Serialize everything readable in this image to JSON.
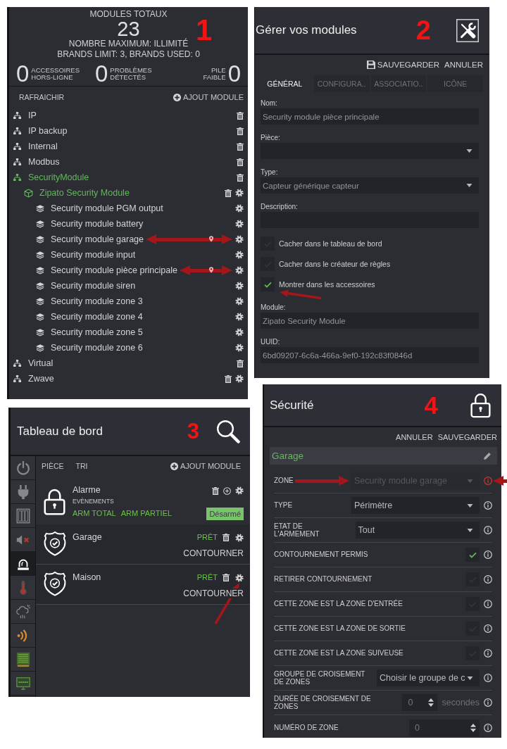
{
  "modules_panel": {
    "annotation_number": "1",
    "summary": {
      "title": "MODULES TOTAUX",
      "total": "23",
      "maximum": "NOMBRE MAXIMUM: ILLIMITÉ",
      "brands": "BRANDS LIMIT: 3, BRANDS USED: 0"
    },
    "counters": [
      {
        "kind": "number-first",
        "value": "0",
        "label": "ACCESSOIRES HORS-LIGNE"
      },
      {
        "kind": "number-first",
        "value": "0",
        "label": "PROBLÈMES DÉTECTÉS"
      },
      {
        "kind": "label-first",
        "value": "0",
        "label": "PILE FAIBLE"
      }
    ],
    "toolbar": {
      "refresh": "RAFRAICHIR",
      "add_button": "AJOUT MODULE"
    },
    "tree": [
      {
        "name": "IP",
        "selected": false,
        "deletable": true,
        "configurable": false
      },
      {
        "name": "IP backup",
        "selected": false,
        "deletable": true,
        "configurable": false
      },
      {
        "name": "Internal",
        "selected": false,
        "deletable": true,
        "configurable": false
      },
      {
        "name": "Modbus",
        "selected": false,
        "deletable": true,
        "configurable": false
      },
      {
        "name": "SecurityModule",
        "selected": true,
        "deletable": true,
        "configurable": false,
        "children": [
          {
            "name": "Zipato Security Module",
            "selected": true,
            "deletable": true,
            "configurable": true,
            "children": [
              {
                "name": "Security module PGM output",
                "selected": false,
                "deletable": false,
                "configurable": true,
                "arrow": false,
                "location_pin": false
              },
              {
                "name": "Security module battery",
                "selected": false,
                "deletable": false,
                "configurable": true,
                "arrow": false,
                "location_pin": false
              },
              {
                "name": "Security module garage",
                "selected": false,
                "deletable": false,
                "configurable": true,
                "arrow": true,
                "location_pin": true
              },
              {
                "name": "Security module input",
                "selected": false,
                "deletable": false,
                "configurable": true,
                "arrow": false,
                "location_pin": false
              },
              {
                "name": "Security module pièce principale",
                "selected": false,
                "deletable": false,
                "configurable": true,
                "arrow": true,
                "location_pin": true
              },
              {
                "name": "Security module siren",
                "selected": false,
                "deletable": false,
                "configurable": true,
                "arrow": false,
                "location_pin": false
              },
              {
                "name": "Security module zone 3",
                "selected": false,
                "deletable": false,
                "configurable": true,
                "arrow": false,
                "location_pin": false
              },
              {
                "name": "Security module zone 4",
                "selected": false,
                "deletable": false,
                "configurable": true,
                "arrow": false,
                "location_pin": false
              },
              {
                "name": "Security module zone 5",
                "selected": false,
                "deletable": false,
                "configurable": true,
                "arrow": false,
                "location_pin": false
              },
              {
                "name": "Security module zone 6",
                "selected": false,
                "deletable": false,
                "configurable": true,
                "arrow": false,
                "location_pin": false
              }
            ]
          }
        ]
      },
      {
        "name": "Virtual",
        "selected": false,
        "deletable": true,
        "configurable": false
      },
      {
        "name": "Zwave",
        "selected": false,
        "deletable": true,
        "configurable": true
      }
    ]
  },
  "module_editor": {
    "title": "Gérer vos modules",
    "annotation_number": "2",
    "actions": [
      {
        "kind": "save",
        "label": "SAUVEGARDER"
      },
      {
        "kind": "cancel",
        "label": "ANNULER"
      }
    ],
    "tabs": [
      {
        "label": "GÉNÉRAL",
        "selected": true
      },
      {
        "label": "CONFIGURA..",
        "selected": false
      },
      {
        "label": "ASSOCIATIO..",
        "selected": false
      },
      {
        "label": "ICÔNE",
        "selected": false
      }
    ],
    "fields": [
      {
        "kind": "text",
        "label": "Nom:",
        "value": "Security module pièce principale"
      },
      {
        "kind": "select",
        "label": "Pièce:"
      },
      {
        "kind": "select",
        "label": "Type:",
        "value": "Capteur générique capteur"
      },
      {
        "kind": "textarea",
        "label": "Description:"
      },
      {
        "kind": "checkbox",
        "label": "Cacher dans le tableau de bord",
        "checked": false,
        "arrow": false
      },
      {
        "kind": "checkbox",
        "label": "Cacher dans le créateur de règles",
        "checked": false,
        "arrow": false
      },
      {
        "kind": "checkbox",
        "label": "Montrer dans les accessoires",
        "checked": true,
        "arrow": true
      },
      {
        "kind": "text",
        "label": "Module:",
        "value": "Zipato Security Module"
      },
      {
        "kind": "text",
        "label": "UUID:",
        "value": "6bd09207-6c6a-466a-9ef0-192c83f0846d"
      }
    ]
  },
  "dashboard": {
    "title": "Tableau de bord",
    "annotation_number": "3",
    "sidebar": [
      {
        "selected": false
      },
      {
        "selected": false
      },
      {
        "selected": false
      },
      {
        "selected": false
      },
      {
        "selected": true
      },
      {
        "selected": false
      },
      {
        "selected": false
      },
      {
        "selected": false
      },
      {
        "selected": false
      },
      {
        "selected": false
      }
    ],
    "toolbar": {
      "room": "PIÈCE",
      "sort": "TRI",
      "add_button": "AJOUT MODULE"
    },
    "cards": [
      {
        "kind": "alarm",
        "name": "Alarme",
        "events_label": "EVÈNEMENTS",
        "modes": [
          {
            "label": "ARM TOTAL",
            "selected": false
          },
          {
            "label": "ARM PARTIEL",
            "selected": false
          },
          {
            "label": "Désarmé",
            "selected": true
          }
        ]
      },
      {
        "kind": "zone",
        "name": "Garage",
        "status": "PRÊT",
        "action": "CONTOURNER",
        "arrow": false
      },
      {
        "kind": "zone",
        "name": "Maison",
        "status": "PRÊT",
        "action": "CONTOURNER",
        "arrow": true
      }
    ]
  },
  "security_panel": {
    "title": "Sécurité",
    "annotation_number": "4",
    "actions": [
      "ANNULER",
      "SAUVEGARDER"
    ],
    "zone_name": "Garage",
    "rows": [
      {
        "kind": "select",
        "label": "ZONE",
        "value": "Security module garage",
        "disabled": true,
        "error": true,
        "arrow": true
      },
      {
        "kind": "select",
        "label": "TYPE",
        "value": "Périmètre",
        "disabled": false,
        "error": false,
        "arrow": false
      },
      {
        "kind": "select",
        "label": "ETAT DE L'ARMEMENT",
        "value": "Tout",
        "disabled": false,
        "error": false,
        "arrow": false
      },
      {
        "kind": "checkbox",
        "label": "CONTOURNEMENT PERMIS",
        "checked": true,
        "error": false,
        "arrow": false
      },
      {
        "kind": "checkbox",
        "label": "RETIRER CONTOURNEMENT",
        "checked": false,
        "error": false,
        "arrow": false
      },
      {
        "kind": "checkbox",
        "label": "CETTE ZONE EST LA ZONE D'ENTRÉE",
        "checked": false,
        "error": false,
        "arrow": false
      },
      {
        "kind": "checkbox",
        "label": "CETTE ZONE EST LA ZONE DE SORTIE",
        "checked": false,
        "error": false,
        "arrow": false
      },
      {
        "kind": "checkbox",
        "label": "CETTE ZONE EST LA ZONE SUIVEUSE",
        "checked": false,
        "error": false,
        "arrow": false
      },
      {
        "kind": "select",
        "label": "GROUPE DE CROISEMENT DE ZONES",
        "value": "Choisir le groupe de c",
        "disabled": false,
        "error": false,
        "arrow": false
      },
      {
        "kind": "duration",
        "label": "DURÉE DE CROISEMENT DE ZONES",
        "value": "0",
        "unit": "secondes",
        "error": false,
        "arrow": false
      },
      {
        "kind": "number",
        "label": "NUMÉRO DE ZONE",
        "value": "0",
        "error": false,
        "arrow": false
      }
    ]
  }
}
